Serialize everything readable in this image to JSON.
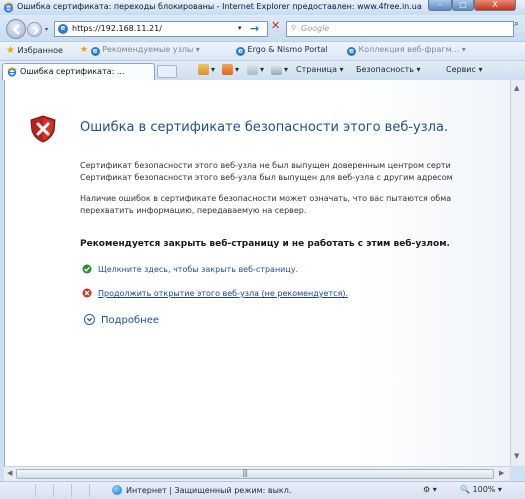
{
  "window": {
    "title": "Ошибка сертификата: переходы блокированы - Internet Explorer предоставлен: www.4free.in.ua",
    "controls": {
      "minimize": "–",
      "maximize": "□",
      "close": "X"
    }
  },
  "address_bar": {
    "url": "https://192.168.11.21/",
    "search_placeholder": "Google"
  },
  "favorites_bar": {
    "favorites_label": "Избранное",
    "items": [
      "Рекомендуемые узлы ▾",
      "Ergo & Nismo Portal",
      "Коллекция веб-фрагм... ▾"
    ]
  },
  "tab": {
    "label": "Ошибка сертификата: ..."
  },
  "command_bar": {
    "page": "Страница ▾",
    "safety": "Безопасность ▾",
    "tools": "Сервис ▾"
  },
  "content": {
    "title": "Ошибка в сертификате безопасности этого веб-узла.",
    "para1_line1": "Сертификат безопасности этого веб-узла не был выпущен доверенным центром серти",
    "para1_line2": "Сертификат безопасности этого веб-узла был выпущен для веб-узла с другим адресом",
    "para2_line1": "Наличие ошибок в сертификате безопасности может означать, что вас пытаются обма",
    "para2_line2": "перехватить информацию, передаваемую на сервер.",
    "recommendation": "Рекомендуется закрыть веб-страницу и не работать с этим веб-узлом.",
    "action_close": "Щелкните здесь, чтобы закрыть веб-страницу.",
    "action_continue": "Продолжить открытие этого веб-узла (не рекомендуется).",
    "more_info": "Подробнее"
  },
  "status_bar": {
    "zone": "Интернет | Защищенный режим: выкл.",
    "zoom": "100%"
  },
  "colors": {
    "title_blue": "#1f4f8c",
    "link_blue": "#1b3fa0",
    "error_red": "#c5321e",
    "ok_green": "#2e8b2e"
  }
}
